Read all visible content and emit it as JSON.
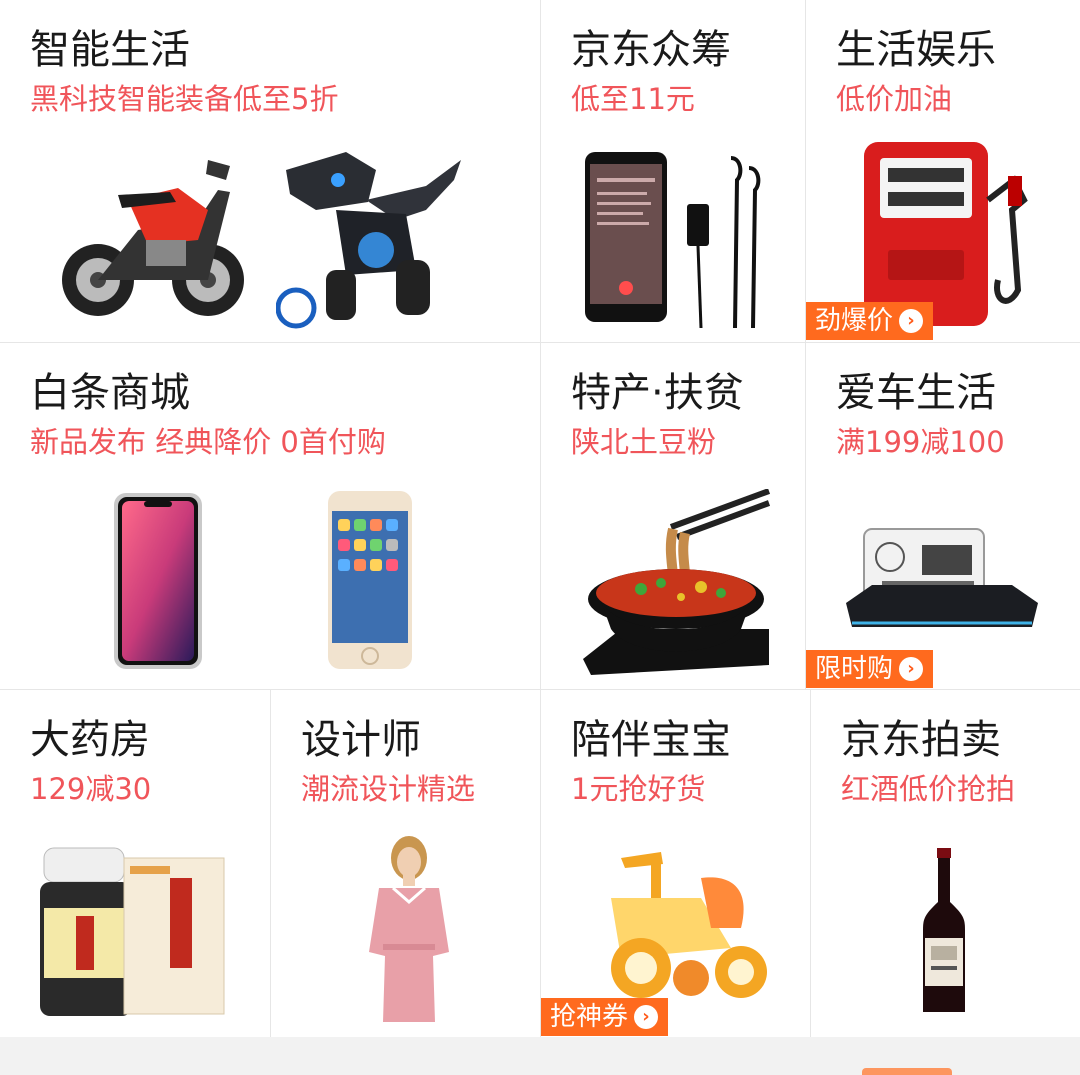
{
  "rows": [
    [
      {
        "title": "智能生活",
        "subtitle": "黑科技智能装备低至5折"
      },
      {
        "title": "京东众筹",
        "subtitle": "低至11元"
      },
      {
        "title": "生活娱乐",
        "subtitle": "低价加油",
        "badge": "劲爆价"
      }
    ],
    [
      {
        "title": "白条商城",
        "subtitle": "新品发布 经典降价 0首付购"
      },
      {
        "title": "特产·扶贫",
        "subtitle": "陕北土豆粉"
      },
      {
        "title": "爱车生活",
        "subtitle": "满199减100",
        "badge": "限时购"
      }
    ],
    [
      {
        "title": "大药房",
        "subtitle": "129减30"
      },
      {
        "title": "设计师",
        "subtitle": "潮流设计精选"
      },
      {
        "title": "陪伴宝宝",
        "subtitle": "1元抢好货",
        "badge": "抢神券"
      },
      {
        "title": "京东拍卖",
        "subtitle": "红酒低价抢拍"
      }
    ]
  ],
  "product_images": {
    "smart_life": [
      "electric-motorcycle",
      "robot-dinosaur"
    ],
    "crowdfunding": [
      "smartphone",
      "bluetooth-earphones"
    ],
    "entertainment": [
      "red-fuel-pump"
    ],
    "baitiao": [
      "iphone-x",
      "iphone-gold"
    ],
    "specialty": [
      "noodle-bowl"
    ],
    "car_life": [
      "car-dashboard-clock"
    ],
    "pharmacy": [
      "medicine-bottle-and-box"
    ],
    "designer": [
      "fashion-model-pink-dress"
    ],
    "baby": [
      "kids-tricycle"
    ],
    "auction": [
      "red-wine-bottle"
    ]
  },
  "colors": {
    "title": "#1a1a1a",
    "subtitle": "#f0555a",
    "badge": "#ff6a1e",
    "divider": "#e6e6e6"
  }
}
